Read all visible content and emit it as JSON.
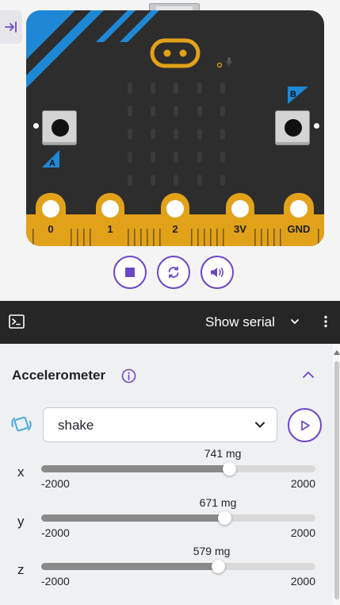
{
  "simulator": {
    "collapse_icon": "collapse-right-icon",
    "pins": [
      "0",
      "1",
      "2",
      "3V",
      "GND"
    ],
    "button_a_label": "A",
    "button_b_label": "B",
    "controls": [
      {
        "name": "stop-button",
        "icon": "stop-icon"
      },
      {
        "name": "reset-button",
        "icon": "reset-icon"
      },
      {
        "name": "sound-button",
        "icon": "speaker-icon"
      }
    ],
    "accent_color": "#6b47c8",
    "edge_color": "#e1a21a",
    "corner_color": "#1e88d6"
  },
  "serial_bar": {
    "icon": "terminal-icon",
    "label": "Show serial",
    "chevron_icon": "chevron-down-icon",
    "menu_icon": "more-vertical-icon"
  },
  "accelerometer": {
    "title": "Accelerometer",
    "info_icon": "info-icon",
    "collapse_icon": "chevron-up-icon",
    "gesture_icon": "shake-gesture-icon",
    "gesture_value": "shake",
    "play_icon": "play-icon",
    "axes": [
      {
        "label": "x",
        "value": 741,
        "value_text": "741 mg",
        "min": "-2000",
        "max": "2000"
      },
      {
        "label": "y",
        "value": 671,
        "value_text": "671 mg",
        "min": "-2000",
        "max": "2000"
      },
      {
        "label": "z",
        "value": 579,
        "value_text": "579 mg",
        "min": "-2000",
        "max": "2000"
      }
    ]
  }
}
